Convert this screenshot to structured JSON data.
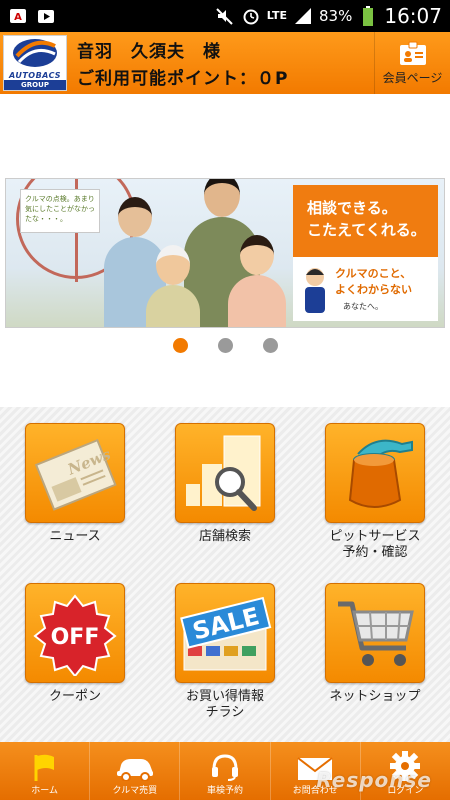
{
  "status_bar": {
    "battery": "83%",
    "time": "16:07",
    "network": "LTE"
  },
  "header": {
    "user_name": "音羽　久須夫　様",
    "points_text": "ご利用可能ポイント：０P",
    "member_label": "会員ページ",
    "logo_brand": "AUTOBACS",
    "logo_group": "GROUP"
  },
  "banner": {
    "bubble_text": "クルマの点検。あまり気にしたことがなかったな・・・。",
    "headline_line1": "相談できる。",
    "headline_line2": "こたえてくれる。",
    "sub_line1": "クルマのこと、",
    "sub_line2": "よくわからない",
    "sub_line3": "あなたへ。"
  },
  "carousel": {
    "count": 3,
    "active_index": 0
  },
  "menu": {
    "news": "ニュース",
    "store_search": "店舗検索",
    "pit_service": "ピットサービス\n予約・確認",
    "coupon": "クーポン",
    "flyer": "お買い得情報\nチラシ",
    "net_shop": "ネットショップ"
  },
  "nav": {
    "home": "ホーム",
    "car_trade": "クルマ売買",
    "inspection": "車検予約",
    "contact": "お問合わせ",
    "login": "ログイン"
  },
  "watermark": "Response",
  "colors": {
    "accent": "#f27a00",
    "brand_blue": "#1c3e96"
  }
}
